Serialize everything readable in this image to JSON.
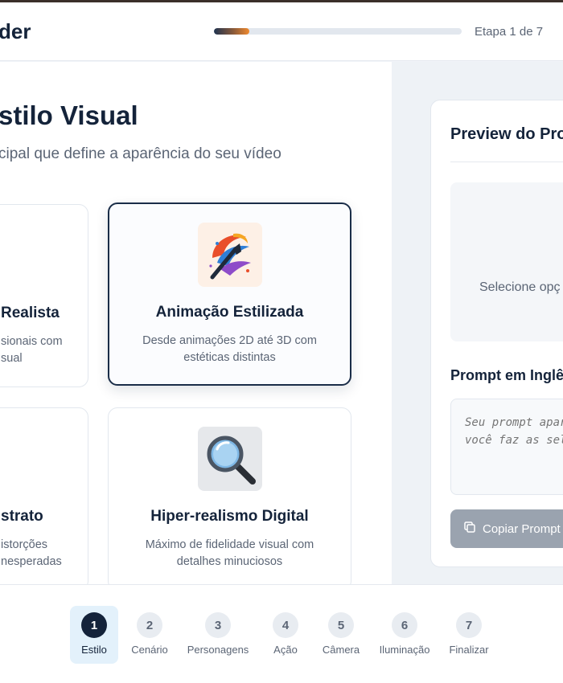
{
  "header": {
    "brand": "der",
    "progress_fraction": 0.143,
    "step_indicator": "Etapa 1 de 7"
  },
  "main": {
    "title": "stilo Visual",
    "subtitle": "cipal que define a aparência do seu vídeo",
    "cards": [
      {
        "title": "Realista",
        "desc_line1": "sionais com",
        "desc_line2": "sual",
        "selected": false
      },
      {
        "title": "Animação Estilizada",
        "desc_line1": "Desde animações 2D até 3D com",
        "desc_line2": "estéticas distintas",
        "icon": "paintbrush-swirl-icon",
        "selected": true
      },
      {
        "title": "strato",
        "desc_line1": "istorções",
        "desc_line2": "nesperadas",
        "selected": false
      },
      {
        "title": "Hiper-realismo Digital",
        "desc_line1": "Máximo de fidelidade visual com",
        "desc_line2": "detalhes minuciosos",
        "icon": "magnifying-glass-icon",
        "selected": false
      }
    ]
  },
  "sidebar": {
    "preview_title": "Preview do Pro",
    "preview_hint": "Selecione opç",
    "prompt_label": "Prompt em Inglê",
    "prompt_placeholder": "Seu prompt apar\nvocê faz as sel",
    "copy_button": "Copiar Prompt"
  },
  "steps": [
    {
      "number": "1",
      "label": "Estilo",
      "active": true
    },
    {
      "number": "2",
      "label": "Cenário",
      "active": false
    },
    {
      "number": "3",
      "label": "Personagens",
      "active": false
    },
    {
      "number": "4",
      "label": "Ação",
      "active": false
    },
    {
      "number": "5",
      "label": "Câmera",
      "active": false
    },
    {
      "number": "6",
      "label": "Iluminação",
      "active": false
    },
    {
      "number": "7",
      "label": "Finalizar",
      "active": false
    }
  ],
  "colors": {
    "navy": "#14233a",
    "accent_orange": "#f08a2e",
    "muted_text": "#5b6575",
    "button_disabled": "#9aa3af",
    "active_step_bg": "#e3f1fb"
  }
}
